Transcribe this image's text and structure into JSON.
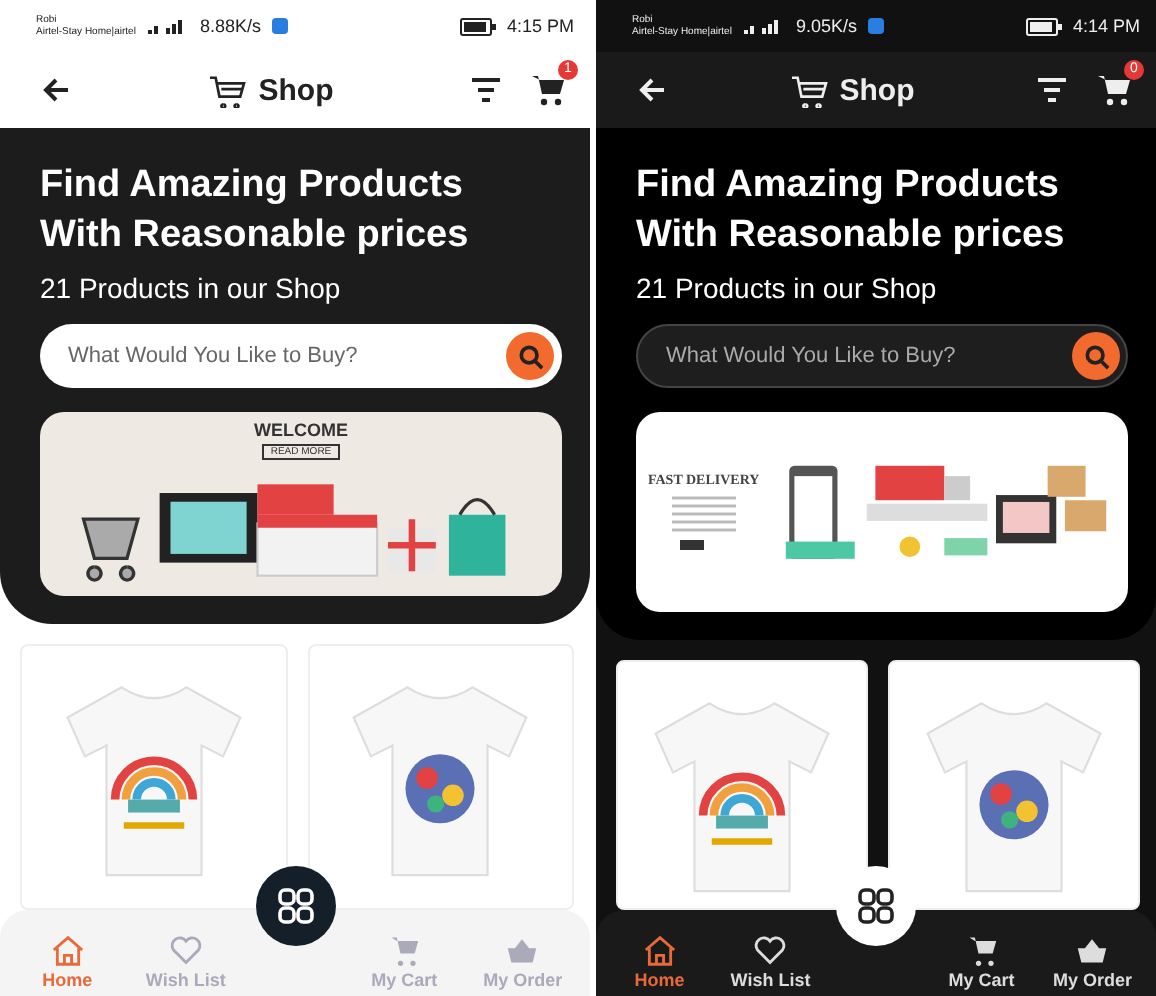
{
  "screens": [
    {
      "kind": "light",
      "status_bar": {
        "carrier": "Robi",
        "network": "Airtel-Stay Home|airtel",
        "speed": "8.88K/s",
        "time": "4:15 PM"
      },
      "app_bar": {
        "title": "Shop",
        "cart_badge": "1"
      },
      "hero": {
        "headline_lines": [
          "Find Amazing Products",
          "With Reasonable prices"
        ],
        "subtitle": "21 Products in our Shop"
      },
      "search": {
        "placeholder": "What Would You Like to Buy?"
      },
      "banner": {
        "kind": "welcome",
        "title": "WELCOME",
        "button": "READ MORE"
      },
      "products": [
        {
          "kind": "rainbow"
        },
        {
          "kind": "sticker"
        }
      ],
      "nav": [
        {
          "kind": "home",
          "label": "Home",
          "selected": true
        },
        {
          "kind": "heart",
          "label": "Wish List",
          "selected": false
        },
        {
          "kind": "cart",
          "label": "My Cart",
          "selected": false
        },
        {
          "kind": "basket",
          "label": "My Order",
          "selected": false
        }
      ]
    },
    {
      "kind": "dark",
      "status_bar": {
        "carrier": "Robi",
        "network": "Airtel-Stay Home|airtel",
        "speed": "9.05K/s",
        "time": "4:14 PM"
      },
      "app_bar": {
        "title": "Shop",
        "cart_badge": "0"
      },
      "hero": {
        "headline_lines": [
          "Find Amazing Products",
          "With Reasonable prices"
        ],
        "subtitle": "21 Products in our Shop"
      },
      "search": {
        "placeholder": "What Would You Like to Buy?"
      },
      "banner": {
        "kind": "delivery",
        "title": "FAST DELIVERY"
      },
      "products": [
        {
          "kind": "rainbow"
        },
        {
          "kind": "sticker"
        }
      ],
      "nav": [
        {
          "kind": "home",
          "label": "Home",
          "selected": true
        },
        {
          "kind": "heart",
          "label": "Wish List",
          "selected": false
        },
        {
          "kind": "cart",
          "label": "My Cart",
          "selected": false
        },
        {
          "kind": "basket",
          "label": "My Order",
          "selected": false
        }
      ]
    }
  ]
}
